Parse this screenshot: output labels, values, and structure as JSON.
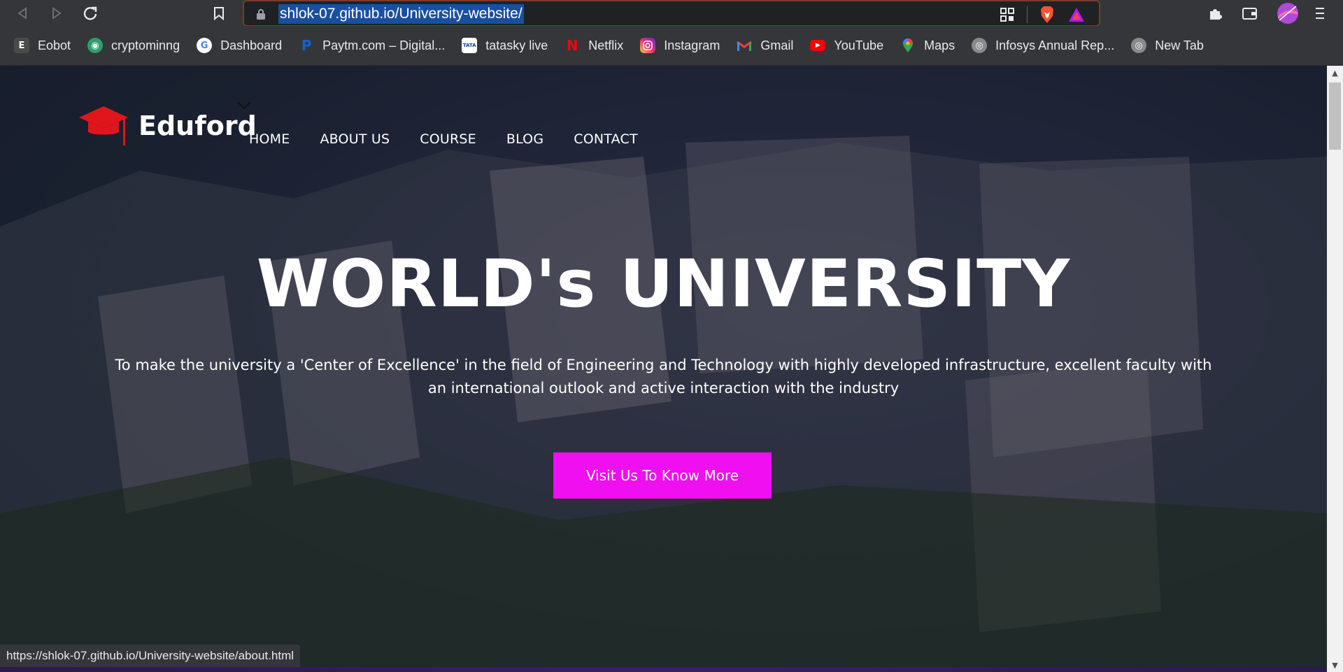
{
  "browser": {
    "url": "shlok-07.github.io/University-website/",
    "status_url": "https://shlok-07.github.io/University-website/about.html",
    "nav_icons": [
      "back-icon",
      "forward-icon",
      "reload-icon",
      "bookmark-icon"
    ],
    "extension_icons": [
      "qr-icon",
      "brave-shield-icon",
      "brave-rewards-icon",
      "extensions-icon",
      "wallet-icon",
      "profile-icon",
      "menu-icon"
    ]
  },
  "bookmarks": [
    {
      "label": "Eobot",
      "icon": "eobot-icon",
      "color": "#555555"
    },
    {
      "label": "cryptominng",
      "icon": "globe-green-icon",
      "color": "#2e9e6a"
    },
    {
      "label": "Dashboard",
      "icon": "google-icon",
      "color": "#ffffff"
    },
    {
      "label": "Paytm.com – Digital...",
      "icon": "paytm-icon",
      "color": "#1a3c8f"
    },
    {
      "label": "tatasky live",
      "icon": "tatasky-icon",
      "color": "#ffffff"
    },
    {
      "label": "Netflix",
      "icon": "netflix-icon",
      "color": "#e50914"
    },
    {
      "label": "Instagram",
      "icon": "instagram-icon",
      "color": "#c13584"
    },
    {
      "label": "Gmail",
      "icon": "gmail-icon",
      "color": "#ffffff"
    },
    {
      "label": "YouTube",
      "icon": "youtube-icon",
      "color": "#ff0000"
    },
    {
      "label": "Maps",
      "icon": "maps-icon",
      "color": "#34a853"
    },
    {
      "label": "Infosys Annual Rep...",
      "icon": "globe-icon",
      "color": "#8a8a8a"
    },
    {
      "label": "New Tab",
      "icon": "globe-icon",
      "color": "#8a8a8a"
    }
  ],
  "site": {
    "logo_text": "Eduford",
    "nav": [
      "HOME",
      "ABOUT US",
      "COURSE",
      "BLOG",
      "CONTACT"
    ],
    "hero_title": "WORLD's UNIVERSITY",
    "hero_subtitle": "To make the university a 'Center of Excellence' in the field of Engineering and Technology with highly developed infrastructure, excellent faculty with an international outlook and active interaction with the industry",
    "cta_label": "Visit Us To Know More",
    "accent_color": "#f00ff0",
    "logo_color": "#e0161c"
  }
}
